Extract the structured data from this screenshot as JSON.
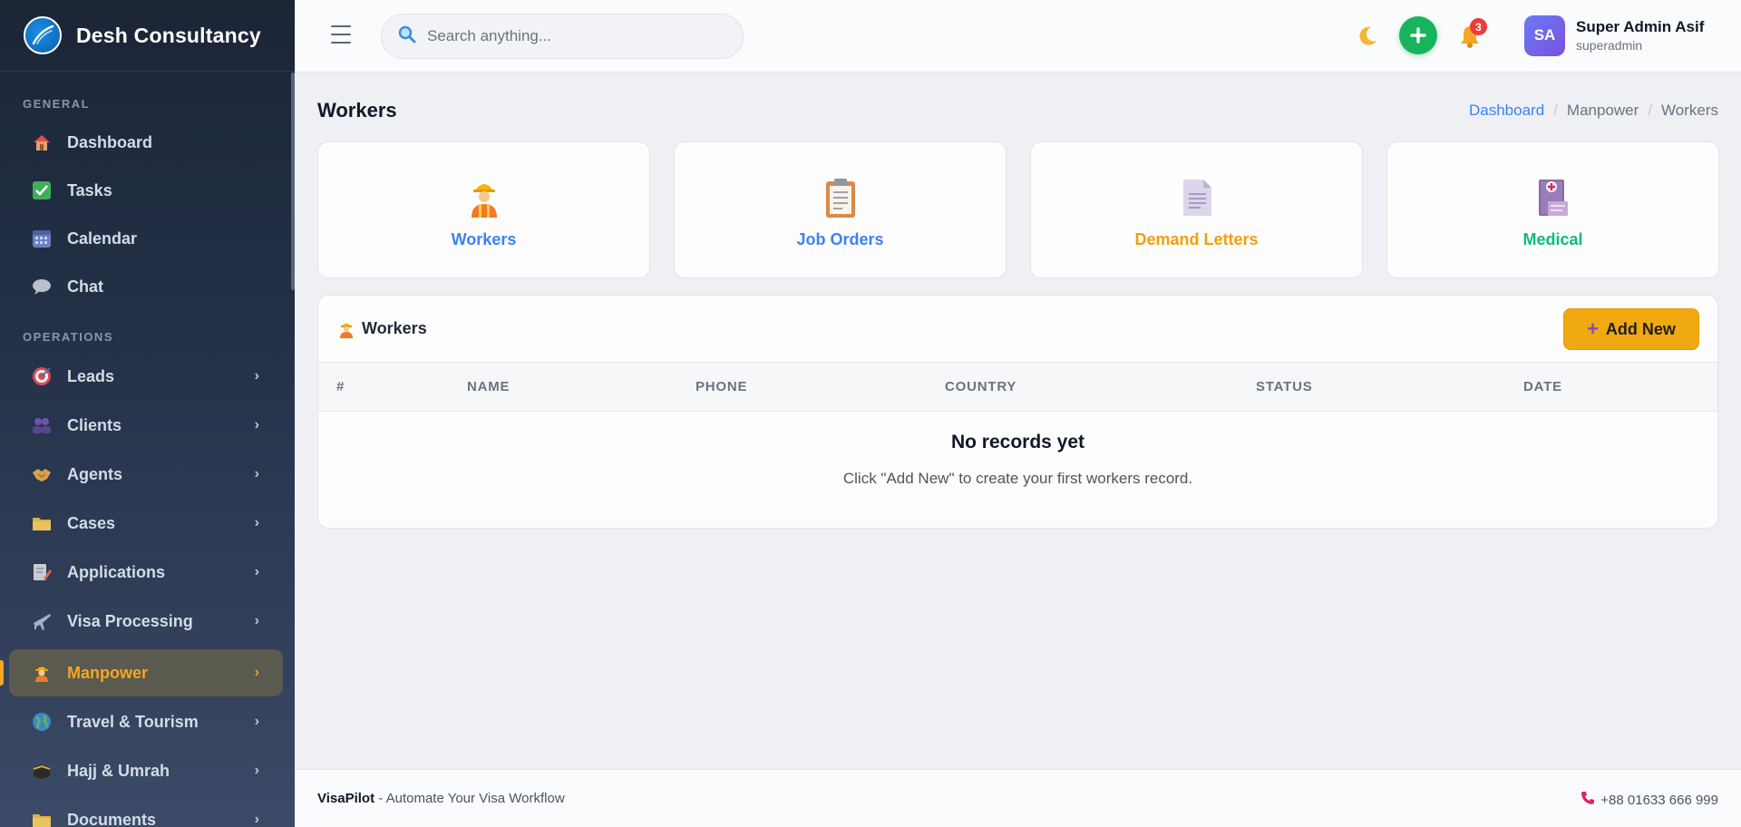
{
  "brand": {
    "name": "Desh Consultancy"
  },
  "sidebar": {
    "sections": [
      {
        "title": "GENERAL"
      },
      {
        "title": "OPERATIONS"
      }
    ],
    "items": [
      {
        "label": "Dashboard",
        "icon": "house-icon"
      },
      {
        "label": "Tasks",
        "icon": "check-box-icon"
      },
      {
        "label": "Calendar",
        "icon": "calendar-icon"
      },
      {
        "label": "Chat",
        "icon": "speech-bubble-icon"
      },
      {
        "label": "Leads",
        "icon": "target-icon"
      },
      {
        "label": "Clients",
        "icon": "people-icon"
      },
      {
        "label": "Agents",
        "icon": "handshake-icon"
      },
      {
        "label": "Cases",
        "icon": "folder-icon"
      },
      {
        "label": "Applications",
        "icon": "document-pen-icon"
      },
      {
        "label": "Visa Processing",
        "icon": "airplane-icon"
      },
      {
        "label": "Manpower",
        "icon": "worker-icon",
        "active": true
      },
      {
        "label": "Travel & Tourism",
        "icon": "globe-icon"
      },
      {
        "label": "Hajj & Umrah",
        "icon": "kaaba-icon"
      },
      {
        "label": "Documents",
        "icon": "folder-icon"
      }
    ]
  },
  "topbar": {
    "search_placeholder": "Search anything...",
    "notification_count": "3",
    "user": {
      "initials": "SA",
      "name": "Super Admin Asif",
      "role": "superadmin"
    }
  },
  "page": {
    "title": "Workers",
    "breadcrumb": [
      "Dashboard",
      "Manpower",
      "Workers"
    ]
  },
  "cards": [
    {
      "label": "Workers",
      "color": "#3b82f6",
      "icon": "construction-worker-icon"
    },
    {
      "label": "Job Orders",
      "color": "#3b82f6",
      "icon": "clipboard-icon"
    },
    {
      "label": "Demand Letters",
      "color": "#f59e0b",
      "icon": "page-icon"
    },
    {
      "label": "Medical",
      "color": "#10b981",
      "icon": "medical-file-icon"
    }
  ],
  "panel": {
    "title": "Workers",
    "add_label": "Add New",
    "columns": [
      "#",
      "NAME",
      "PHONE",
      "COUNTRY",
      "STATUS",
      "DATE"
    ],
    "empty_title": "No records yet",
    "empty_sub": "Click \"Add New\" to create your first workers record."
  },
  "footer": {
    "brand": "VisaPilot",
    "tagline": "- Automate Your Visa Workflow",
    "phone": "+88 01633 666 999"
  }
}
